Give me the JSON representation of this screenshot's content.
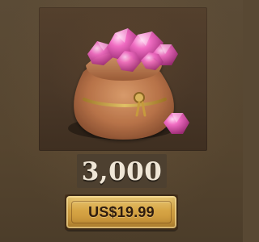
{
  "item": {
    "icon": "gem-pouch-icon",
    "amount": "3,000"
  },
  "purchase": {
    "price_label": "US$19.99"
  },
  "colors": {
    "background": "#584833",
    "card": "#4a3828",
    "button_gold": "#d6a545",
    "gem_pink": "#e55db0",
    "pouch_brown": "#b9744b"
  }
}
